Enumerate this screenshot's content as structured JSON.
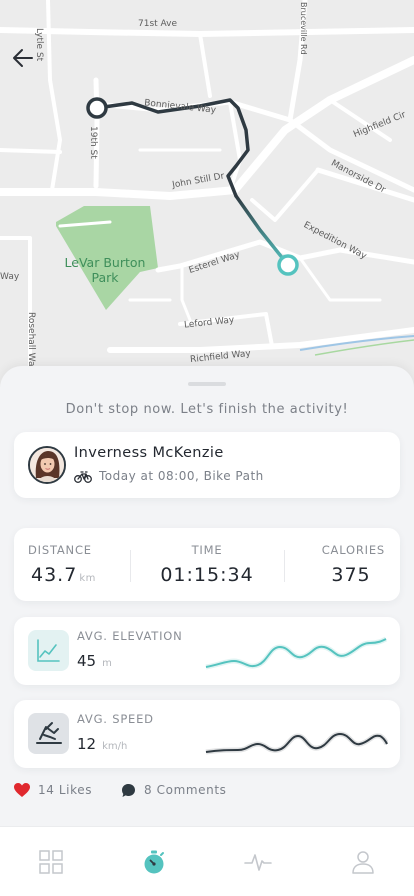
{
  "map": {
    "streets": {
      "ave71": "71st Ave",
      "lytle": "Lytle St",
      "st19": "19th St",
      "waverly": "Bonnievale Way",
      "highfield": "Highfield Cir",
      "manorside": "Manorside Dr",
      "john_still": "John Still Dr",
      "expedition": "Expedition Way",
      "esterel": "Esterel Way",
      "way_left": "Way",
      "leford": "Leford Way",
      "richfield": "Richfield Way",
      "rosehall": "Rosehall Way",
      "south_street": "Bruceville Rd"
    },
    "park": "LeVar Burton Park",
    "route_start_color": "#2f3a42",
    "route_end_color": "#55c3bf"
  },
  "sheet": {
    "motivation": "Don't stop now. Let's finish the activity!"
  },
  "user": {
    "name": "Inverness McKenzie",
    "meta": "Today at 08:00, Bike Path",
    "activity_icon": "bicycle-icon"
  },
  "stats": {
    "distance_label": "DISTANCE",
    "distance_value": "43.7",
    "distance_unit": "km",
    "time_label": "TIME",
    "time_value": "01:15:34",
    "calories_label": "CALORIES",
    "calories_value": "375"
  },
  "elevation": {
    "label": "AVG. ELEVATION",
    "value": "45",
    "unit": "m",
    "icon": "line-chart-icon",
    "accent": "#55c3bf"
  },
  "speed": {
    "label": "AVG. SPEED",
    "value": "12",
    "unit": "km/h",
    "icon": "speed-icon",
    "accent": "#2f3a42"
  },
  "social": {
    "likes": "14 Likes",
    "comments": "8 Comments",
    "like_color": "#e0282e"
  },
  "tabbar": {
    "items": [
      "grid-icon",
      "stopwatch-icon",
      "activity-icon",
      "profile-icon"
    ],
    "active_color": "#55c3bf"
  }
}
